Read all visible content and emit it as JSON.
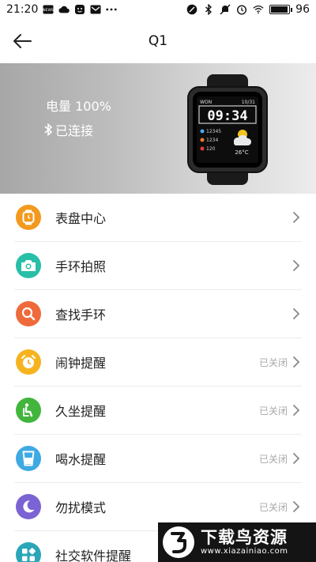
{
  "status_bar": {
    "time": "21:20",
    "battery_level": "96",
    "left_icons": [
      "news-icon",
      "cloud-icon",
      "kid-face-icon",
      "mail-icon",
      "more-dots-icon"
    ],
    "right_icons": [
      "nfc-icon",
      "bluetooth-icon",
      "mute-icon",
      "alarm-icon",
      "wifi-icon",
      "battery-icon"
    ]
  },
  "header": {
    "title": "Q1"
  },
  "banner": {
    "battery_text": "电量 100%",
    "connection_text": "已连接",
    "watch": {
      "time": "09:34",
      "top_left": "WON",
      "top_right": "10/31",
      "steps": "12345",
      "calories": "1234",
      "heart": "120",
      "temperature": "26°C"
    }
  },
  "menu": {
    "items": [
      {
        "label": "表盘中心",
        "status": "",
        "icon": "watch-face-icon",
        "color": "#f39a1e"
      },
      {
        "label": "手环拍照",
        "status": "",
        "icon": "camera-icon",
        "color": "#27bfa7"
      },
      {
        "label": "查找手环",
        "status": "",
        "icon": "search-icon",
        "color": "#ef6a3a"
      },
      {
        "label": "闹钟提醒",
        "status": "已关闭",
        "icon": "alarm-clock-icon",
        "color": "#f5b41f"
      },
      {
        "label": "久坐提醒",
        "status": "已关闭",
        "icon": "sedentary-icon",
        "color": "#42b53d"
      },
      {
        "label": "喝水提醒",
        "status": "已关闭",
        "icon": "water-cup-icon",
        "color": "#3fa9e3"
      },
      {
        "label": "勿扰模式",
        "status": "已关闭",
        "icon": "moon-icon",
        "color": "#7b63d4"
      },
      {
        "label": "社交软件提醒",
        "status": "",
        "icon": "apps-icon",
        "color": "#2aa6b8"
      }
    ]
  },
  "watermark": {
    "title": "下载鸟资源",
    "url": "www.xiazainiao.com"
  }
}
